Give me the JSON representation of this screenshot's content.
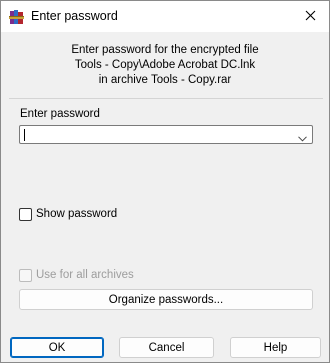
{
  "window": {
    "title": "Enter password",
    "app_icon": "winrar-books-icon",
    "close_icon": "close-icon"
  },
  "message": {
    "line1": "Enter password for the encrypted file",
    "line2": "Tools - Copy\\Adobe Acrobat DC.lnk",
    "line3": "in archive Tools - Copy.rar"
  },
  "password": {
    "label": "Enter password",
    "value": "",
    "dropdown_icon": "chevron-down-icon"
  },
  "show_password": {
    "label": "Show password",
    "checked": false
  },
  "use_for_all": {
    "label": "Use for all archives",
    "checked": false,
    "enabled": false
  },
  "organize_button": {
    "label": "Organize passwords..."
  },
  "buttons": {
    "ok": "OK",
    "cancel": "Cancel",
    "help": "Help"
  },
  "colors": {
    "accent": "#0067c0",
    "dialog_bg": "#f0f0f0"
  }
}
